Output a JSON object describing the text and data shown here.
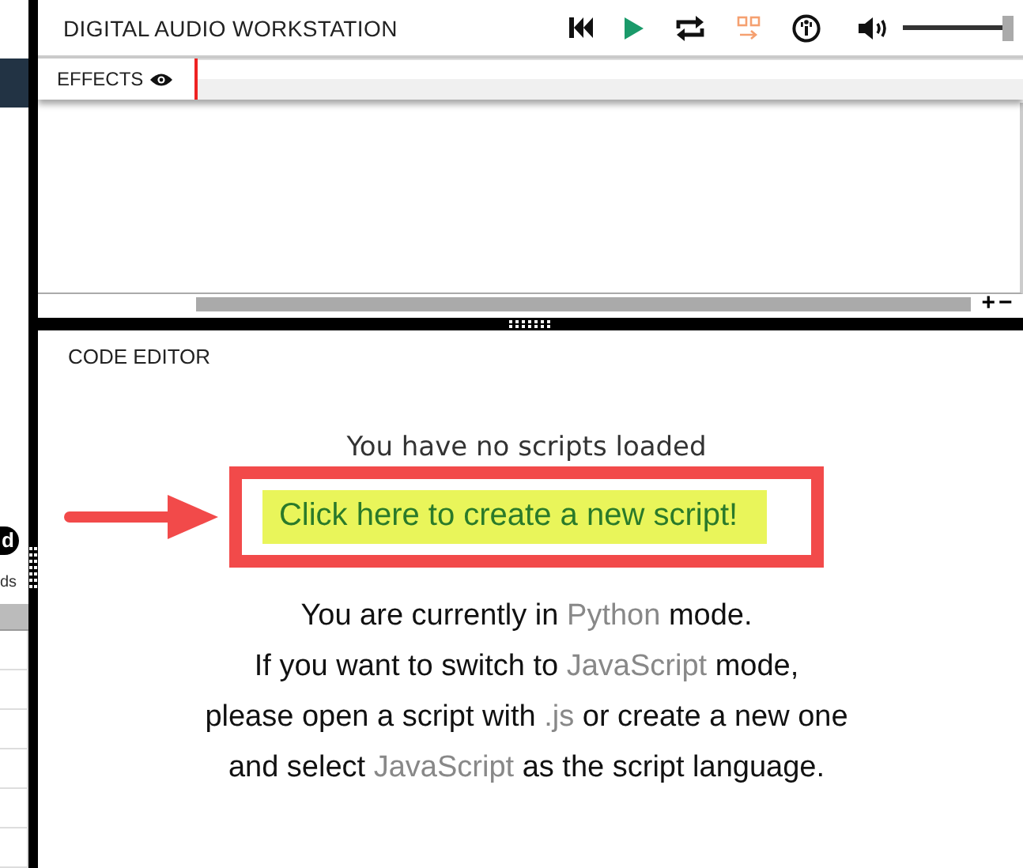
{
  "side_panel": {
    "badge": "d",
    "caption": "ds"
  },
  "daw": {
    "title": "DIGITAL AUDIO WORKSTATION",
    "controls": [
      {
        "kind": "rewind"
      },
      {
        "kind": "play"
      },
      {
        "kind": "loop"
      },
      {
        "kind": "follow"
      },
      {
        "kind": "metronome"
      }
    ],
    "volume": {
      "level": 1
    },
    "effects_tab": {
      "label": "EFFECTS"
    },
    "zoom": [
      "+",
      "−"
    ]
  },
  "code_editor": {
    "title": "CODE EDITOR",
    "empty_message": "You have no scripts loaded",
    "create_link": "Click here to create a new script!",
    "info_lines": [
      [
        {
          "text": "You are currently in ",
          "kind": "plain"
        },
        {
          "text": "Python",
          "kind": "language"
        },
        {
          "text": " mode.",
          "kind": "plain"
        }
      ],
      [
        {
          "text": "If you want to switch to ",
          "kind": "plain"
        },
        {
          "text": "JavaScript",
          "kind": "language"
        },
        {
          "text": " mode,",
          "kind": "plain"
        }
      ],
      [
        {
          "text": "please open a script with ",
          "kind": "plain"
        },
        {
          "text": ".js",
          "kind": "language"
        },
        {
          "text": " or create a new one",
          "kind": "plain"
        }
      ],
      [
        {
          "text": "and select ",
          "kind": "plain"
        },
        {
          "text": "JavaScript",
          "kind": "language"
        },
        {
          "text": " as the script language.",
          "kind": "plain"
        }
      ]
    ]
  }
}
